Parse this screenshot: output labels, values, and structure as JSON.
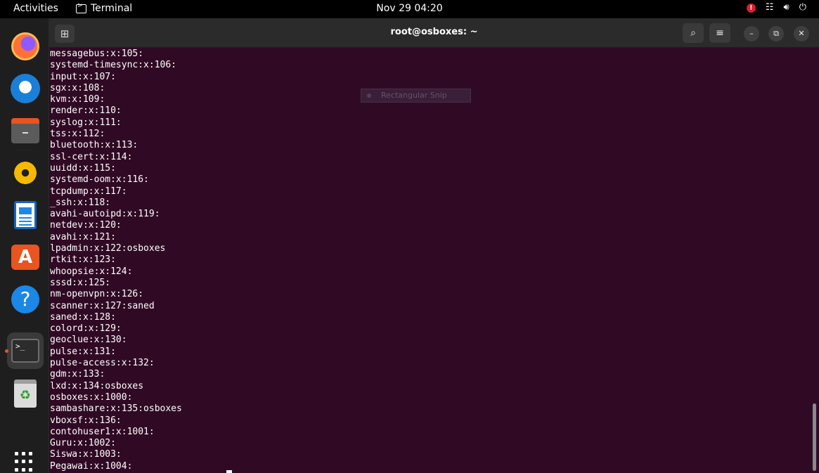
{
  "topbar": {
    "activities": "Activities",
    "app_name": "Terminal",
    "clock": "Nov 29  04:20",
    "icons": [
      "alert-icon",
      "network-icon",
      "volume-icon",
      "power-icon"
    ]
  },
  "dock": {
    "items": [
      "firefox",
      "thunderbird",
      "files",
      "rhythmbox",
      "libreoffice-writer",
      "app-center",
      "help",
      "terminal",
      "trash"
    ],
    "active": "terminal"
  },
  "window": {
    "title": "root@osboxes: ~",
    "buttons": [
      "new-tab",
      "search",
      "menu",
      "minimize",
      "maximize",
      "close"
    ]
  },
  "terminal": {
    "lines": [
      "messagebus:x:105:",
      "systemd-timesync:x:106:",
      "input:x:107:",
      "sgx:x:108:",
      "kvm:x:109:",
      "render:x:110:",
      "syslog:x:111:",
      "tss:x:112:",
      "bluetooth:x:113:",
      "ssl-cert:x:114:",
      "uuidd:x:115:",
      "systemd-oom:x:116:",
      "tcpdump:x:117:",
      "_ssh:x:118:",
      "avahi-autoipd:x:119:",
      "netdev:x:120:",
      "avahi:x:121:",
      "lpadmin:x:122:osboxes",
      "rtkit:x:123:",
      "whoopsie:x:124:",
      "sssd:x:125:",
      "nm-openvpn:x:126:",
      "scanner:x:127:saned",
      "saned:x:128:",
      "colord:x:129:",
      "geoclue:x:130:",
      "pulse:x:131:",
      "pulse-access:x:132:",
      "gdm:x:133:",
      "lxd:x:134:osboxes",
      "osboxes:x:1000:",
      "sambashare:x:135:osboxes",
      "vboxsf:x:136:",
      "contohuser1:x:1001:",
      "Guru:x:1002:",
      "Siswa:x:1003:",
      "Pegawai:x:1004:"
    ]
  },
  "overlay": {
    "snip_label": "Rectangular Snip"
  },
  "colors": {
    "terminal_bg": "#300a24",
    "accent": "#e95420"
  }
}
